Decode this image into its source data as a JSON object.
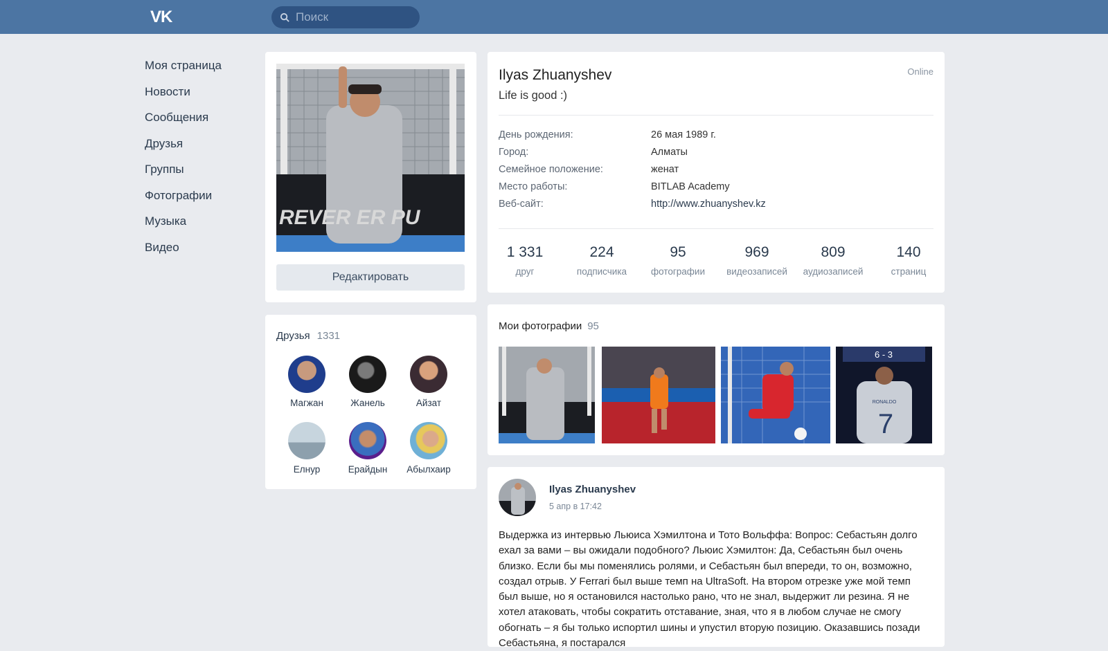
{
  "header": {
    "logo": "VK",
    "search_placeholder": "Поиск"
  },
  "nav": {
    "items": [
      "Моя страница",
      "Новости",
      "Сообщения",
      "Друзья",
      "Группы",
      "Фотографии",
      "Музыка",
      "Видео"
    ]
  },
  "avatar_card": {
    "photo_text": "REVER ER PU",
    "edit_label": "Редактировать"
  },
  "friends": {
    "title": "Друзья",
    "count": "1331",
    "items": [
      {
        "name": "Магжан"
      },
      {
        "name": "Жанель"
      },
      {
        "name": "Айзат"
      },
      {
        "name": "Елнур"
      },
      {
        "name": "Ерайдын"
      },
      {
        "name": "Абылхаир"
      }
    ]
  },
  "profile": {
    "name": "Ilyas Zhuanyshev",
    "status": "Life is good :)",
    "online": "Online",
    "info": [
      {
        "label": "День рождения:",
        "value": "26 мая 1989 г."
      },
      {
        "label": "Город:",
        "value": "Алматы"
      },
      {
        "label": "Семейное положение:",
        "value": "женат"
      },
      {
        "label": "Место работы:",
        "value": "BITLAB Academy"
      },
      {
        "label": "Веб-сайт:",
        "value": "http://www.zhuanyshev.kz"
      }
    ],
    "stats": [
      {
        "num": "1 331",
        "label": "друг"
      },
      {
        "num": "224",
        "label": "подписчика"
      },
      {
        "num": "95",
        "label": "фотографии"
      },
      {
        "num": "969",
        "label": "видеозаписей"
      },
      {
        "num": "809",
        "label": "аудиозаписей"
      },
      {
        "num": "140",
        "label": "страниц"
      }
    ]
  },
  "photos": {
    "title": "Мои фотографии",
    "count": "95",
    "jersey_name": "RONALDO",
    "jersey_number": "7",
    "score": "6 - 3"
  },
  "post": {
    "author": "Ilyas Zhuanyshev",
    "date": "5 апр в 17:42",
    "text": "Выдержка из интервью Льюиса Хэмилтона и Тото Вольффа: Вопрос: Себастьян долго ехал за вами – вы ожидали подобного? Льюис Хэмилтон: Да, Себастьян был очень близко. Если бы мы поменялись ролями, и Себастьян был впереди, то он, возможно, создал отрыв. У Ferrari был выше темп на UltraSoft. На втором отрезке уже мой темп был выше, но я остановился настолько рано, что не знал, выдержит ли резина. Я не хотел атаковать, чтобы сократить отставание, зная, что я в любом случае не смогу обогнать – я бы только испортил шины и упустил вторую позицию. Оказавшись позади Себастьяна, я постарался"
  },
  "colors": {
    "header": "#4c75a3",
    "search_bg": "#2f5382",
    "page_bg": "#e9ebef",
    "link": "#2a3a4d"
  }
}
